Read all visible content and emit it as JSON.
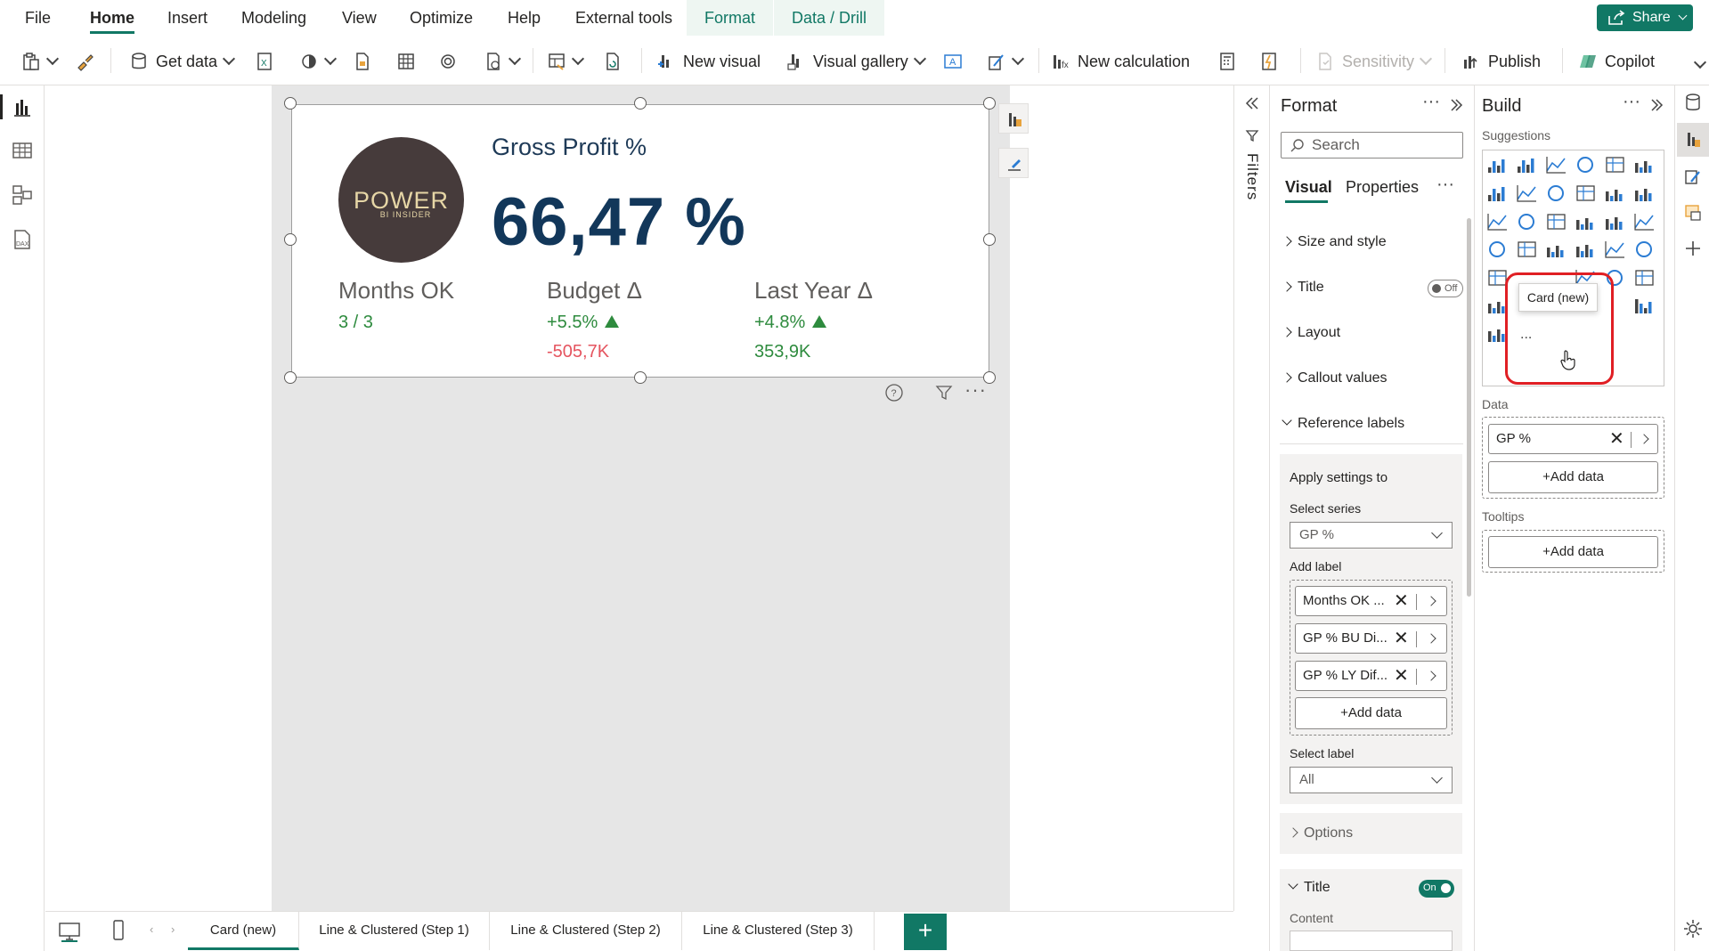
{
  "menu": {
    "items": [
      "File",
      "Home",
      "Insert",
      "Modeling",
      "View",
      "Optimize",
      "Help",
      "External tools"
    ],
    "active": "Home",
    "context_tabs": [
      "Format",
      "Data / Drill"
    ],
    "share": "Share"
  },
  "ribbon": {
    "get_data": "Get data",
    "new_visual": "New visual",
    "visual_gallery": "Visual gallery",
    "new_calculation": "New calculation",
    "sensitivity": "Sensitivity",
    "publish": "Publish",
    "copilot": "Copilot"
  },
  "card": {
    "logo_text": "POWER",
    "logo_sub": "BI INSIDER",
    "title": "Gross Profit %",
    "value": "66,47 %",
    "refs": [
      {
        "title": "Months OK",
        "value": "3 / 3",
        "value_color": "#2e8b3e"
      },
      {
        "title": "Budget Δ",
        "value": "+5.5%",
        "value2": "-505,7K",
        "value_color": "#2e8b3e",
        "value2_color": "#e5545f"
      },
      {
        "title": "Last Year Δ",
        "value": "+4.8%",
        "value2": "353,9K",
        "value_color": "#2e8b3e",
        "value2_color": "#2e8b3e"
      }
    ]
  },
  "filters": {
    "label": "Filters"
  },
  "format_pane": {
    "title": "Format",
    "search_placeholder": "Search",
    "tabs": [
      "Visual",
      "Properties"
    ],
    "sections": [
      "Size and style",
      "Title",
      "Layout",
      "Callout values",
      "Reference labels"
    ],
    "title_toggle": "Off",
    "apply_settings": "Apply settings to",
    "select_series_label": "Select series",
    "select_series_value": "GP %",
    "add_label": "Add label",
    "labels": [
      "Months OK ...",
      "GP % BU Di...",
      "GP % LY Dif..."
    ],
    "add_data": "+Add data",
    "select_label_label": "Select label",
    "select_label_value": "All",
    "options": "Options",
    "title2": "Title",
    "title2_toggle": "On",
    "content": "Content"
  },
  "build_pane": {
    "title": "Build",
    "suggestions": "Suggestions",
    "tooltip": "Card (new)",
    "data_label": "Data",
    "data_field": "GP %",
    "add_data": "+Add data",
    "tooltips_label": "Tooltips",
    "more": "..."
  },
  "tabs": {
    "items": [
      "Card (new)",
      "Line & Clustered (Step 1)",
      "Line & Clustered (Step 2)",
      "Line & Clustered (Step 3)"
    ],
    "active": "Card (new)",
    "add": "+"
  },
  "colors": {
    "accent": "#117865",
    "positive": "#2e8b3e",
    "negative": "#e5545f",
    "card_value": "#12375a",
    "highlight": "#e01f24"
  }
}
